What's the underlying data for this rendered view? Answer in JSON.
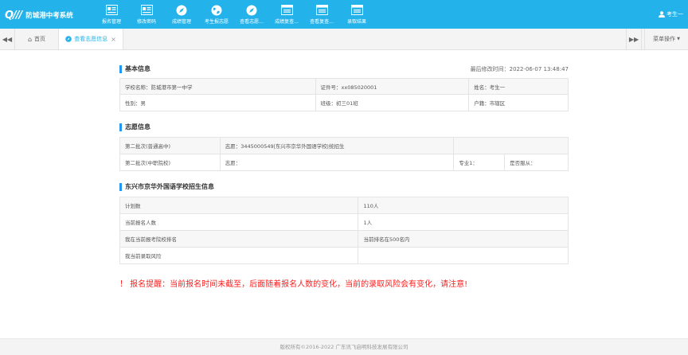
{
  "header": {
    "logo_mark": "Q///",
    "logo_text": "防城港中考系统",
    "nav": [
      {
        "icon": "id-card-icon",
        "label": "报名管理"
      },
      {
        "icon": "id-card-icon",
        "label": "修改密码"
      },
      {
        "icon": "compass-icon",
        "label": "成绩管理"
      },
      {
        "icon": "globe-icon",
        "label": "考生报志愿"
      },
      {
        "icon": "compass-icon",
        "label": "查看志愿..."
      },
      {
        "icon": "window-icon",
        "label": "成绩复查..."
      },
      {
        "icon": "window-icon",
        "label": "查看复查..."
      },
      {
        "icon": "window-icon",
        "label": "录取结果"
      }
    ],
    "user_name": "考生一"
  },
  "tabs": {
    "home_label": "首页",
    "active_label": "查看志愿信息",
    "menu_label": "菜单操作"
  },
  "basic": {
    "title": "基本信息",
    "updated": "最后修改时间：2022-06-07 13:48:47",
    "rows": [
      [
        "学校名称：防城港市第一中学",
        "证件号：xx085020001",
        "姓名：考生一"
      ],
      [
        "性别：男",
        "班级：初三01班",
        "户籍：市辖区"
      ]
    ]
  },
  "wish": {
    "title": "志愿信息",
    "rows": [
      [
        "第二批次(普通高中)",
        "志愿：3445000549|东兴市京华外国语学校|统招生",
        "",
        ""
      ],
      [
        "第二批次(中职院校)",
        "志愿：",
        "专业1：",
        "是否服从："
      ]
    ]
  },
  "school": {
    "title": "东兴市京华外国语学校招生信息",
    "rows": [
      [
        "计划数",
        "110人"
      ],
      [
        "当前报名人数",
        "1人"
      ],
      [
        "我在当前报考院校排名",
        "当前排名在500名内"
      ],
      [
        "我当前录取风险",
        ""
      ]
    ]
  },
  "warning": "！ 报名提醒：当前报名时间未截至，后面随着报名人数的变化，当前的录取风险会有变化，请注意!",
  "footer": "版权所有©2016-2022 广东讯飞启明科技发展有限公司",
  "colors": {
    "header_bg": "#23b3ea",
    "accent": "#2196f3",
    "warning": "#ff1e1e"
  }
}
